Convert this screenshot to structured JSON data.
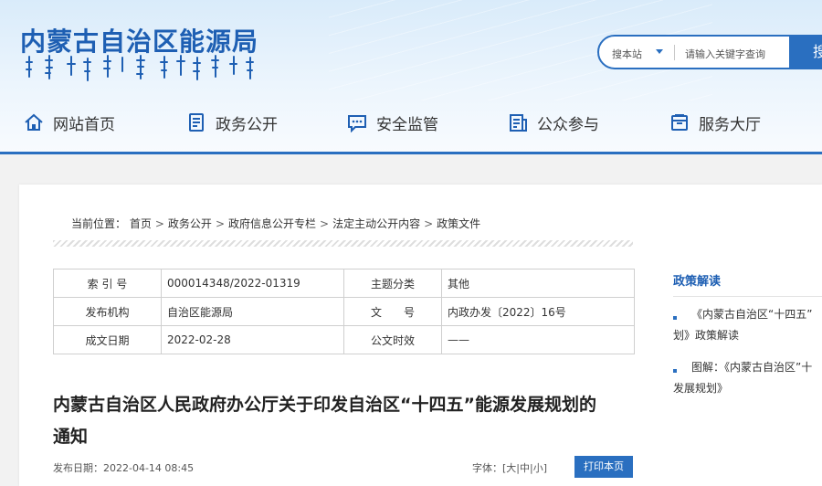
{
  "header": {
    "site_title": "内蒙古自治区能源局",
    "search": {
      "scope_label": "搜本站",
      "placeholder": "请输入关键字查询",
      "button_label": "搜"
    }
  },
  "nav": {
    "items": [
      {
        "label": "网站首页",
        "icon": "home-icon"
      },
      {
        "label": "政务公开",
        "icon": "document-list-icon"
      },
      {
        "label": "安全监管",
        "icon": "chat-bubble-icon"
      },
      {
        "label": "公众参与",
        "icon": "clipboard-icon"
      },
      {
        "label": "服务大厅",
        "icon": "briefcase-icon"
      }
    ]
  },
  "breadcrumb": {
    "prefix": "当前位置：",
    "items": [
      "首页",
      "政务公开",
      "政府信息公开专栏",
      "法定主动公开内容",
      "政策文件"
    ],
    "separator": ">"
  },
  "meta_table": {
    "rows": [
      [
        {
          "k": "索 引 号",
          "v": "000014348/2022-01319"
        },
        {
          "k": "主题分类",
          "v": "其他"
        }
      ],
      [
        {
          "k": "发布机构",
          "v": "自治区能源局"
        },
        {
          "k": "文　　号",
          "v": "内政办发〔2022〕16号"
        }
      ],
      [
        {
          "k": "成文日期",
          "v": "2022-02-28"
        },
        {
          "k": "公文时效",
          "v": "——"
        }
      ]
    ]
  },
  "article": {
    "title": "内蒙古自治区人民政府办公厅关于印发自治区“十四五”能源发展规划的通知",
    "pubdate": "发布日期：2022-04-14 08:45",
    "fontsize_label": "字体：",
    "fontsize_options": [
      "大",
      "中",
      "小"
    ],
    "print_label": "打印本页"
  },
  "sidebar": {
    "title": "政策解读",
    "items": [
      {
        "line1": "《内蒙古自治区“十四五”",
        "line2": "划》政策解读"
      },
      {
        "line1": "图解：《内蒙古自治区”十",
        "line2": "发展规划》"
      }
    ]
  },
  "colors": {
    "brand_blue": "#2a6fc0",
    "title_blue": "#1e5fb3",
    "header_bg": "#e4f0fb"
  }
}
